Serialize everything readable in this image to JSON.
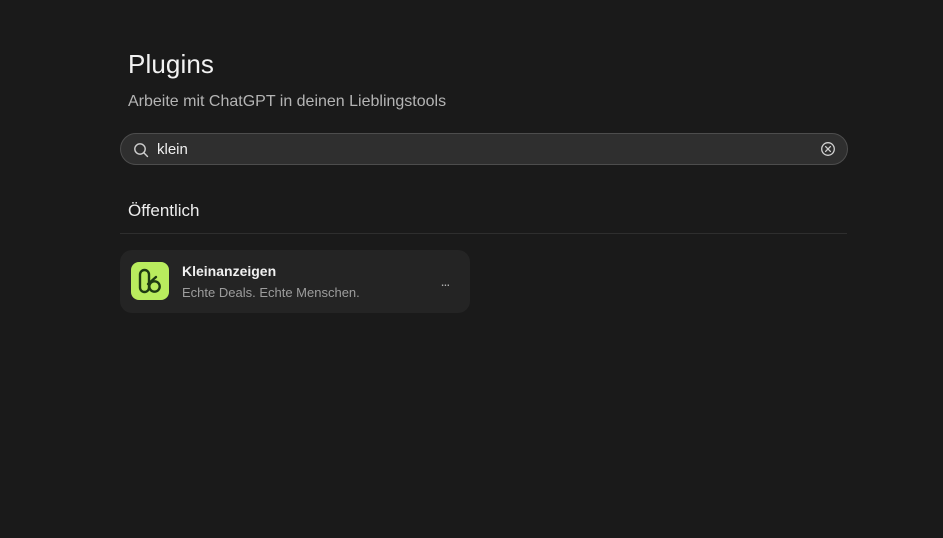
{
  "header": {
    "title": "Plugins",
    "subtitle": "Arbeite mit ChatGPT in deinen Lieblingstools"
  },
  "search": {
    "value": "klein",
    "search_icon": "search-icon",
    "clear_icon": "clear-circle-icon"
  },
  "sections": [
    {
      "heading": "Öffentlich",
      "plugins": [
        {
          "name": "Kleinanzeigen",
          "description": "Echte Deals. Echte Menschen.",
          "logo_icon": "kleinanzeigen-logo",
          "logo_color": "#b9ec5e",
          "more_label": "..."
        }
      ]
    }
  ],
  "colors": {
    "background": "#1a1a1a",
    "card": "#242424",
    "search_background": "#2f2f2f"
  }
}
